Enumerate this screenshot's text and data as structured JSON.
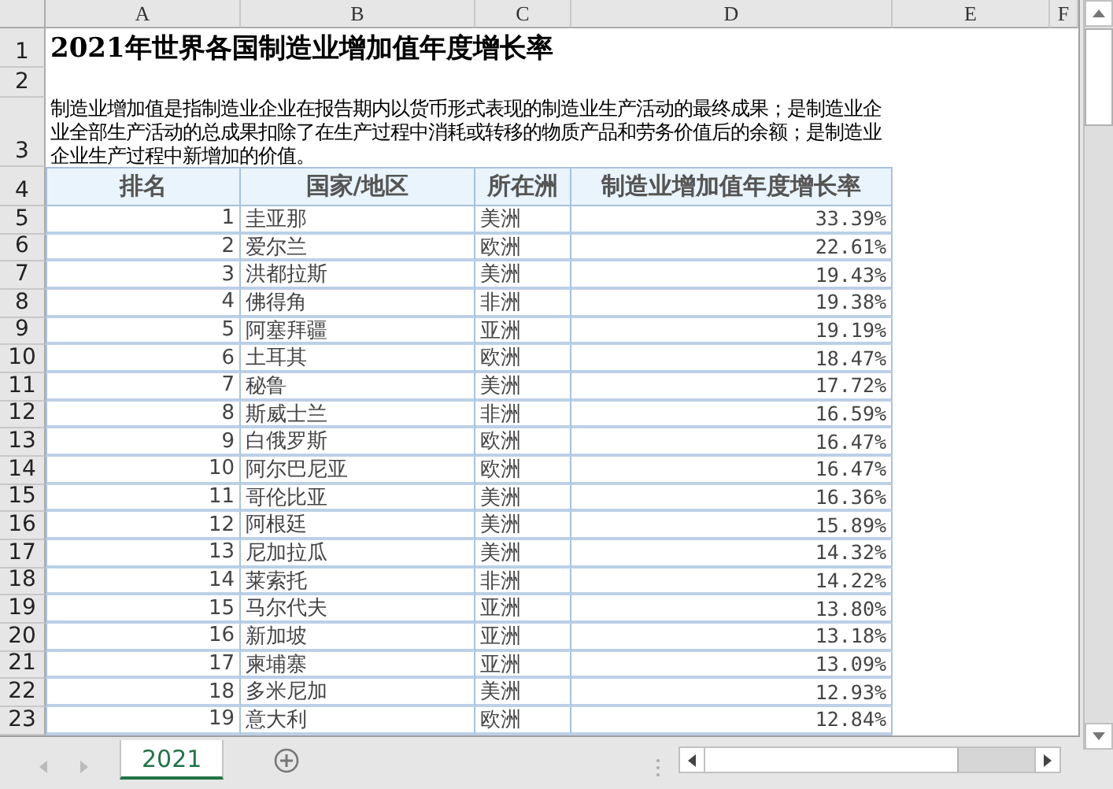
{
  "sheet": {
    "column_headers": [
      "A",
      "B",
      "C",
      "D",
      "E",
      "F"
    ],
    "row_headers": [
      "1",
      "2",
      "3",
      "4",
      "5",
      "6",
      "7",
      "8",
      "9",
      "10",
      "11",
      "12",
      "13",
      "14",
      "15",
      "16",
      "17",
      "18",
      "19",
      "20",
      "21",
      "22",
      "23"
    ],
    "title": "2021年世界各国制造业增加值年度增长率",
    "description": "制造业增加值是指制造业企业在报告期内以货币形式表现的制造业生产活动的最终成果；是制造业企业全部生产活动的总成果扣除了在生产过程中消耗或转移的物质产品和劳务价值后的余额；是制造业企业生产过程中新增加的价值。",
    "table": {
      "columns": [
        "排名",
        "国家/地区",
        "所在洲",
        "制造业增加值年度增长率"
      ],
      "rows": [
        [
          "1",
          "圭亚那",
          "美洲",
          "33.39%"
        ],
        [
          "2",
          "爱尔兰",
          "欧洲",
          "22.61%"
        ],
        [
          "3",
          "洪都拉斯",
          "美洲",
          "19.43%"
        ],
        [
          "4",
          "佛得角",
          "非洲",
          "19.38%"
        ],
        [
          "5",
          "阿塞拜疆",
          "亚洲",
          "19.19%"
        ],
        [
          "6",
          "土耳其",
          "欧洲",
          "18.47%"
        ],
        [
          "7",
          "秘鲁",
          "美洲",
          "17.72%"
        ],
        [
          "8",
          "斯威士兰",
          "非洲",
          "16.59%"
        ],
        [
          "9",
          "白俄罗斯",
          "欧洲",
          "16.47%"
        ],
        [
          "10",
          "阿尔巴尼亚",
          "欧洲",
          "16.47%"
        ],
        [
          "11",
          "哥伦比亚",
          "美洲",
          "16.36%"
        ],
        [
          "12",
          "阿根廷",
          "美洲",
          "15.89%"
        ],
        [
          "13",
          "尼加拉瓜",
          "美洲",
          "14.32%"
        ],
        [
          "14",
          "莱索托",
          "非洲",
          "14.22%"
        ],
        [
          "15",
          "马尔代夫",
          "亚洲",
          "13.80%"
        ],
        [
          "16",
          "新加坡",
          "亚洲",
          "13.18%"
        ],
        [
          "17",
          "柬埔寨",
          "亚洲",
          "13.09%"
        ],
        [
          "18",
          "多米尼加",
          "美洲",
          "12.93%"
        ],
        [
          "19",
          "意大利",
          "欧洲",
          "12.84%"
        ]
      ]
    }
  },
  "sheet_tabs": [
    {
      "label": "2021",
      "selected": true
    }
  ]
}
